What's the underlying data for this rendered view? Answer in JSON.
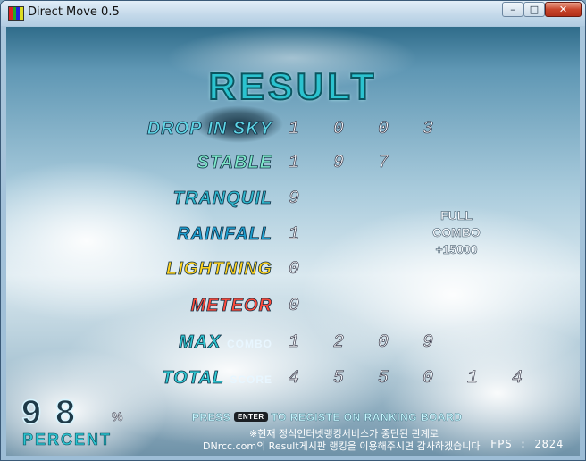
{
  "window": {
    "title": "Direct Move 0.5",
    "minimize_glyph": "–",
    "maximize_glyph": "□",
    "close_glyph": "✕"
  },
  "result": {
    "title": "RESULT",
    "rows": [
      {
        "label": "DROP IN SKY",
        "value": "1 0 0 3",
        "color": "#5fd6e6"
      },
      {
        "label": "STABLE",
        "value": "1 9 7",
        "color": "#7ee8c8"
      },
      {
        "label": "TRANQUIL",
        "value": "9",
        "color": "#2fb6cc"
      },
      {
        "label": "RAINFALL",
        "value": "1",
        "color": "#1e9fd0"
      },
      {
        "label": "LIGHTNING",
        "value": "0",
        "color": "#ffd21e"
      },
      {
        "label": "METEOR",
        "value": "0",
        "color": "#ff4a3a"
      }
    ],
    "max_combo": {
      "label_main": "MAX",
      "label_small": "COMBO",
      "value": "1 2 0 9",
      "color": "#2fc6d0"
    },
    "total_score": {
      "label_main": "TOTAL",
      "label_small": "SCORE",
      "value": "4 5 5 0 1 4",
      "color": "#2fc6d0"
    },
    "full_combo": {
      "line1": "FULL",
      "line2": "COMBO",
      "line3": "+15000"
    },
    "percent": {
      "value": "98",
      "sign": "%",
      "label": "PERCENT"
    }
  },
  "footer": {
    "press_before": "PRESS",
    "enter_key": "ENTER",
    "press_after": "TO REGISTE ON RANKING BOARD",
    "notice_line1": "※현재 정식인터넷랭킹서비스가 중단된 관계로",
    "notice_line2": "DNrcc.com의 Result게시판 랭킹을 이용해주시면 감사하겠습니다",
    "fps": "FPS : 2824"
  }
}
